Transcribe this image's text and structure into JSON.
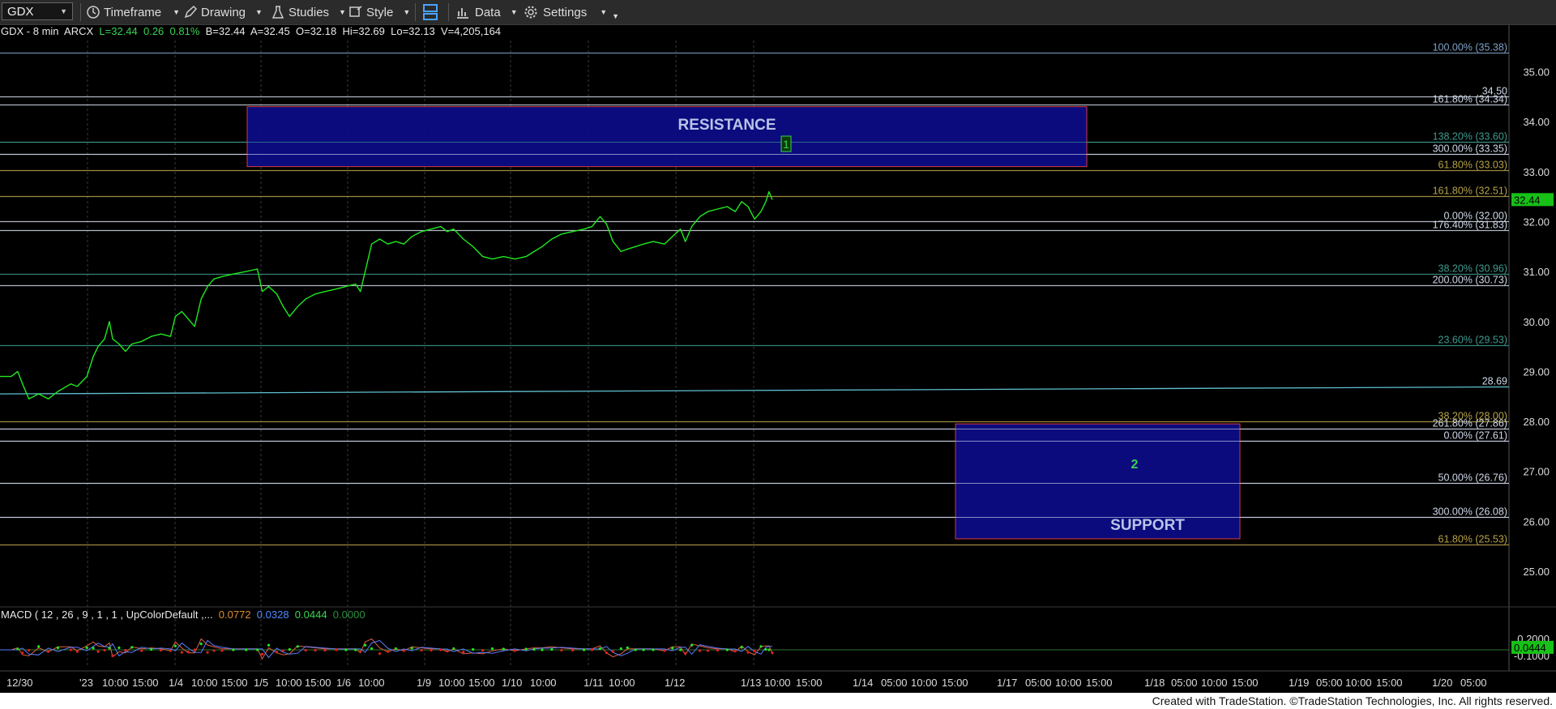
{
  "toolbar": {
    "symbol": "GDX",
    "items": [
      {
        "label": "Timeframe",
        "icon": "clock-icon"
      },
      {
        "label": "Drawing",
        "icon": "pencil-icon"
      },
      {
        "label": "Studies",
        "icon": "flask-icon"
      },
      {
        "label": "Style",
        "icon": "style-icon"
      },
      {
        "label": "",
        "icon": "layout-icon"
      },
      {
        "label": "Data",
        "icon": "bar-chart-icon"
      },
      {
        "label": "Settings",
        "icon": "gear-icon"
      }
    ]
  },
  "info": {
    "symbol": "GDX - 8 min",
    "exchange": "ARCX",
    "last": "L=32.44",
    "change": "0.26",
    "pct": "0.81%",
    "bid": "B=32.44",
    "ask": "A=32.45",
    "open": "O=32.18",
    "high": "Hi=32.69",
    "low": "Lo=32.13",
    "volume": "V=4,205,164"
  },
  "macd_info": {
    "label": "MACD ( 12 , 26 , 9 , 1 , 1 , UpColorDefault ,...",
    "v1": "0.0772",
    "v2": "0.0328",
    "v3": "0.0444",
    "v4": "0.0000"
  },
  "copyright": "Created with TradeStation. ©TradeStation Technologies, Inc. All rights reserved.",
  "chart_data": {
    "type": "line",
    "symbol": "GDX",
    "interval": "8 min",
    "series_color": "#1fe81f",
    "ylim": [
      24.3,
      35.7
    ],
    "y_ticks": [
      "25.00",
      "26.00",
      "27.00",
      "28.00",
      "29.00",
      "30.00",
      "31.00",
      "32.00",
      "33.00",
      "34.00",
      "35.00"
    ],
    "price_label": "32.44",
    "x_ticks": [
      "12/30",
      "'23",
      "10:00",
      "15:00",
      "1/4",
      "10:00",
      "15:00",
      "1/5",
      "10:00",
      "15:00",
      "1/6",
      "10:00",
      "1/9",
      "10:00",
      "15:00",
      "1/10",
      "10:00",
      "1/11",
      "10:00",
      "1/12",
      "1/13",
      "10:00",
      "15:00",
      "1/14",
      "05:00",
      "10:00",
      "15:00",
      "1/17",
      "05:00",
      "10:00",
      "15:00",
      "1/18",
      "05:00",
      "10:00",
      "15:00",
      "1/19",
      "05:00",
      "10:00",
      "15:00",
      "1/20",
      "05:00"
    ],
    "price_path": [
      {
        "t": 0,
        "y": 28.9
      },
      {
        "t": 14,
        "y": 28.9
      },
      {
        "t": 22,
        "y": 29.0
      },
      {
        "t": 28,
        "y": 28.75
      },
      {
        "t": 36,
        "y": 28.45
      },
      {
        "t": 48,
        "y": 28.55
      },
      {
        "t": 60,
        "y": 28.45
      },
      {
        "t": 72,
        "y": 28.6
      },
      {
        "t": 88,
        "y": 28.75
      },
      {
        "t": 96,
        "y": 28.7
      },
      {
        "t": 108,
        "y": 28.9
      },
      {
        "t": 116,
        "y": 29.3
      },
      {
        "t": 122,
        "y": 29.5
      },
      {
        "t": 130,
        "y": 29.65
      },
      {
        "t": 136,
        "y": 30.0
      },
      {
        "t": 140,
        "y": 29.65
      },
      {
        "t": 148,
        "y": 29.55
      },
      {
        "t": 156,
        "y": 29.4
      },
      {
        "t": 164,
        "y": 29.55
      },
      {
        "t": 176,
        "y": 29.6
      },
      {
        "t": 188,
        "y": 29.7
      },
      {
        "t": 200,
        "y": 29.75
      },
      {
        "t": 212,
        "y": 29.7
      },
      {
        "t": 218,
        "y": 30.1
      },
      {
        "t": 226,
        "y": 30.2
      },
      {
        "t": 234,
        "y": 30.05
      },
      {
        "t": 242,
        "y": 29.9
      },
      {
        "t": 250,
        "y": 30.45
      },
      {
        "t": 258,
        "y": 30.7
      },
      {
        "t": 266,
        "y": 30.85
      },
      {
        "t": 276,
        "y": 30.9
      },
      {
        "t": 290,
        "y": 30.95
      },
      {
        "t": 306,
        "y": 31.0
      },
      {
        "t": 320,
        "y": 31.05
      },
      {
        "t": 326,
        "y": 30.6
      },
      {
        "t": 334,
        "y": 30.7
      },
      {
        "t": 344,
        "y": 30.55
      },
      {
        "t": 352,
        "y": 30.3
      },
      {
        "t": 360,
        "y": 30.1
      },
      {
        "t": 370,
        "y": 30.3
      },
      {
        "t": 380,
        "y": 30.45
      },
      {
        "t": 392,
        "y": 30.55
      },
      {
        "t": 404,
        "y": 30.6
      },
      {
        "t": 418,
        "y": 30.65
      },
      {
        "t": 430,
        "y": 30.7
      },
      {
        "t": 442,
        "y": 30.75
      },
      {
        "t": 448,
        "y": 30.6
      },
      {
        "t": 454,
        "y": 31.0
      },
      {
        "t": 462,
        "y": 31.55
      },
      {
        "t": 472,
        "y": 31.65
      },
      {
        "t": 482,
        "y": 31.55
      },
      {
        "t": 492,
        "y": 31.6
      },
      {
        "t": 502,
        "y": 31.55
      },
      {
        "t": 512,
        "y": 31.7
      },
      {
        "t": 524,
        "y": 31.8
      },
      {
        "t": 536,
        "y": 31.85
      },
      {
        "t": 548,
        "y": 31.9
      },
      {
        "t": 556,
        "y": 31.8
      },
      {
        "t": 564,
        "y": 31.85
      },
      {
        "t": 576,
        "y": 31.65
      },
      {
        "t": 588,
        "y": 31.5
      },
      {
        "t": 600,
        "y": 31.3
      },
      {
        "t": 612,
        "y": 31.25
      },
      {
        "t": 626,
        "y": 31.3
      },
      {
        "t": 640,
        "y": 31.25
      },
      {
        "t": 654,
        "y": 31.3
      },
      {
        "t": 664,
        "y": 31.4
      },
      {
        "t": 674,
        "y": 31.5
      },
      {
        "t": 686,
        "y": 31.65
      },
      {
        "t": 698,
        "y": 31.75
      },
      {
        "t": 712,
        "y": 31.8
      },
      {
        "t": 726,
        "y": 31.85
      },
      {
        "t": 736,
        "y": 31.9
      },
      {
        "t": 746,
        "y": 32.1
      },
      {
        "t": 754,
        "y": 31.95
      },
      {
        "t": 762,
        "y": 31.6
      },
      {
        "t": 772,
        "y": 31.4
      },
      {
        "t": 780,
        "y": 31.45
      },
      {
        "t": 790,
        "y": 31.5
      },
      {
        "t": 800,
        "y": 31.55
      },
      {
        "t": 812,
        "y": 31.6
      },
      {
        "t": 826,
        "y": 31.55
      },
      {
        "t": 836,
        "y": 31.7
      },
      {
        "t": 846,
        "y": 31.85
      },
      {
        "t": 852,
        "y": 31.6
      },
      {
        "t": 860,
        "y": 31.9
      },
      {
        "t": 870,
        "y": 32.1
      },
      {
        "t": 880,
        "y": 32.2
      },
      {
        "t": 892,
        "y": 32.25
      },
      {
        "t": 904,
        "y": 32.3
      },
      {
        "t": 914,
        "y": 32.2
      },
      {
        "t": 922,
        "y": 32.4
      },
      {
        "t": 930,
        "y": 32.3
      },
      {
        "t": 938,
        "y": 32.05
      },
      {
        "t": 946,
        "y": 32.2
      },
      {
        "t": 952,
        "y": 32.4
      },
      {
        "t": 956,
        "y": 32.6
      },
      {
        "t": 960,
        "y": 32.44
      }
    ],
    "boxes": [
      {
        "label": "RESISTANCE",
        "y_top": 34.3,
        "y_bottom": 33.1,
        "x0": 305,
        "x1": 1341
      },
      {
        "label": "SUPPORT",
        "y_top": 27.95,
        "y_bottom": 25.65,
        "x0": 1179,
        "x1": 1530
      }
    ],
    "wave_labels": [
      {
        "label": "1",
        "y": 33.55
      },
      {
        "label": "2",
        "y": 27.15
      }
    ],
    "levels": [
      {
        "label": "100.00% (35.38)",
        "y": 35.38,
        "color": "#7fa2c8"
      },
      {
        "label": "34.50",
        "y": 34.5,
        "color": "#cfd8e8"
      },
      {
        "label": "161.80% (34.34)",
        "y": 34.34,
        "color": "#cfd8e8"
      },
      {
        "label": "138.20% (33.60)",
        "y": 33.6,
        "color": "#3f9b8f"
      },
      {
        "label": "300.00% (33.35)",
        "y": 33.35,
        "color": "#cfd8e8"
      },
      {
        "label": "61.80% (33.03)",
        "y": 33.03,
        "color": "#b8a347"
      },
      {
        "label": "161.80% (32.51)",
        "y": 32.51,
        "color": "#b8a347"
      },
      {
        "label": "0.00% (32.00)",
        "y": 32.0,
        "color": "#cfd8e8"
      },
      {
        "label": "176.40% (31.83)",
        "y": 31.83,
        "color": "#cfd8e8"
      },
      {
        "label": "38.20% (30.96)",
        "y": 30.96,
        "color": "#3f9b8f"
      },
      {
        "label": "200.00% (30.73)",
        "y": 30.73,
        "color": "#cfd8e8"
      },
      {
        "label": "23.60% (29.53)",
        "y": 29.53,
        "color": "#3f9b8f"
      },
      {
        "label": "38.20% (28.00)",
        "y": 28.0,
        "color": "#b8a347"
      },
      {
        "label": "261.80% (27.86)",
        "y": 27.86,
        "color": "#cfd8e8"
      },
      {
        "label": "0.00% (27.61)",
        "y": 27.61,
        "color": "#cfd8e8"
      },
      {
        "label": "50.00% (26.76)",
        "y": 26.76,
        "color": "#cfd8e8"
      },
      {
        "label": "300.00% (26.08)",
        "y": 26.08,
        "color": "#cfd8e8"
      },
      {
        "label": "61.80% (25.53)",
        "y": 25.53,
        "color": "#b8a347"
      }
    ],
    "trendline": {
      "label": "28.69",
      "y_start": 28.55,
      "y_end": 28.69,
      "color": "#5fc0d0"
    },
    "macd": {
      "ylim": [
        -0.25,
        0.35
      ],
      "y_ticks": [
        "0.2000",
        "-0.1000"
      ],
      "value_label": "0.0444"
    }
  }
}
